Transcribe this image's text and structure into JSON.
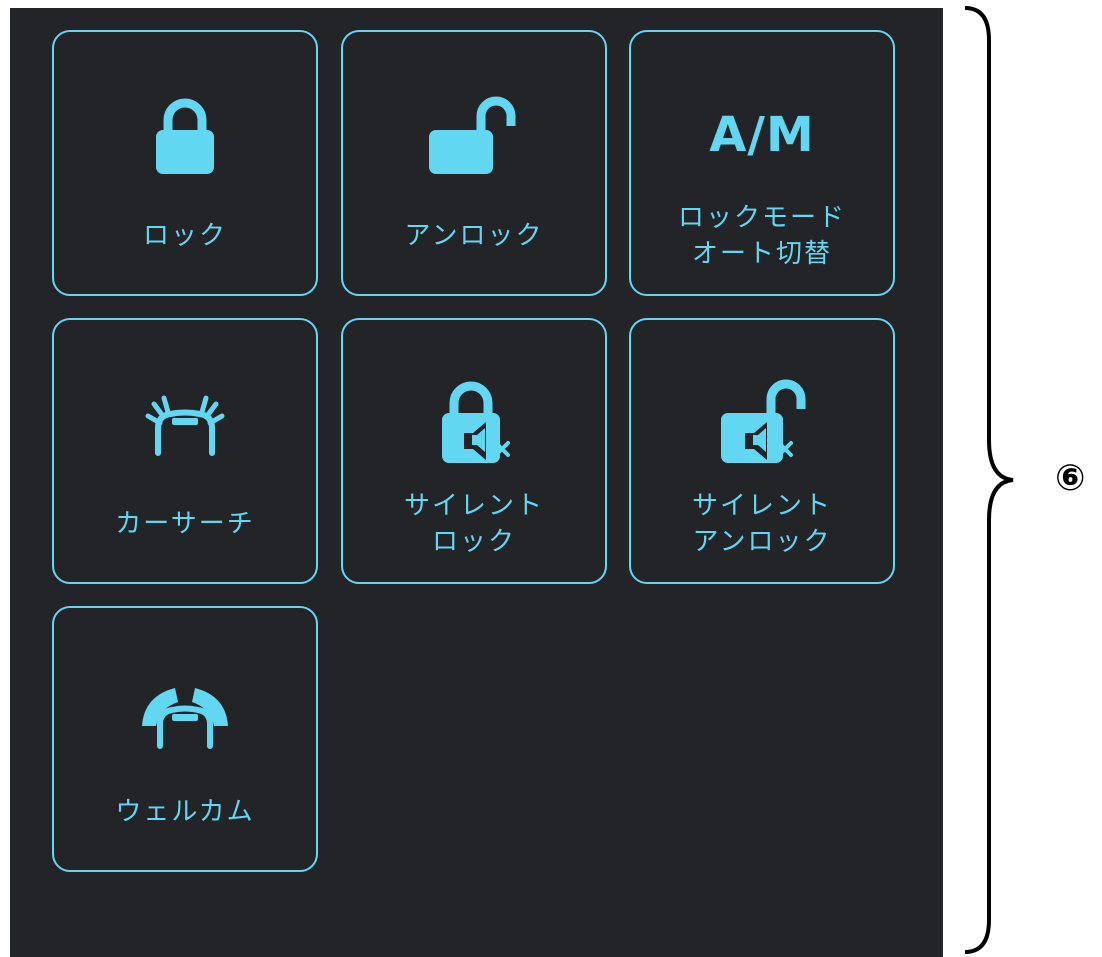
{
  "tiles": [
    {
      "id": "lock",
      "icon": "lock-icon",
      "lines": [
        "ロック"
      ]
    },
    {
      "id": "unlock",
      "icon": "unlock-icon",
      "lines": [
        "アンロック"
      ]
    },
    {
      "id": "auto-mode",
      "icon": "am-icon",
      "icon_text": "A/M",
      "lines": [
        "ロックモード",
        "オート切替"
      ]
    },
    {
      "id": "car-search",
      "icon": "car-search-icon",
      "lines": [
        "カーサーチ"
      ]
    },
    {
      "id": "silent-lock",
      "icon": "silent-lock-icon",
      "lines": [
        "サイレント",
        "ロック"
      ]
    },
    {
      "id": "silent-unlock",
      "icon": "silent-unlock-icon",
      "lines": [
        "サイレント",
        "アンロック"
      ]
    },
    {
      "id": "welcome",
      "icon": "welcome-icon",
      "lines": [
        "ウェルカム"
      ]
    }
  ],
  "annotation": {
    "marker": "⑥"
  },
  "colors": {
    "accent": "#62d7f2",
    "panel": "#232428"
  }
}
